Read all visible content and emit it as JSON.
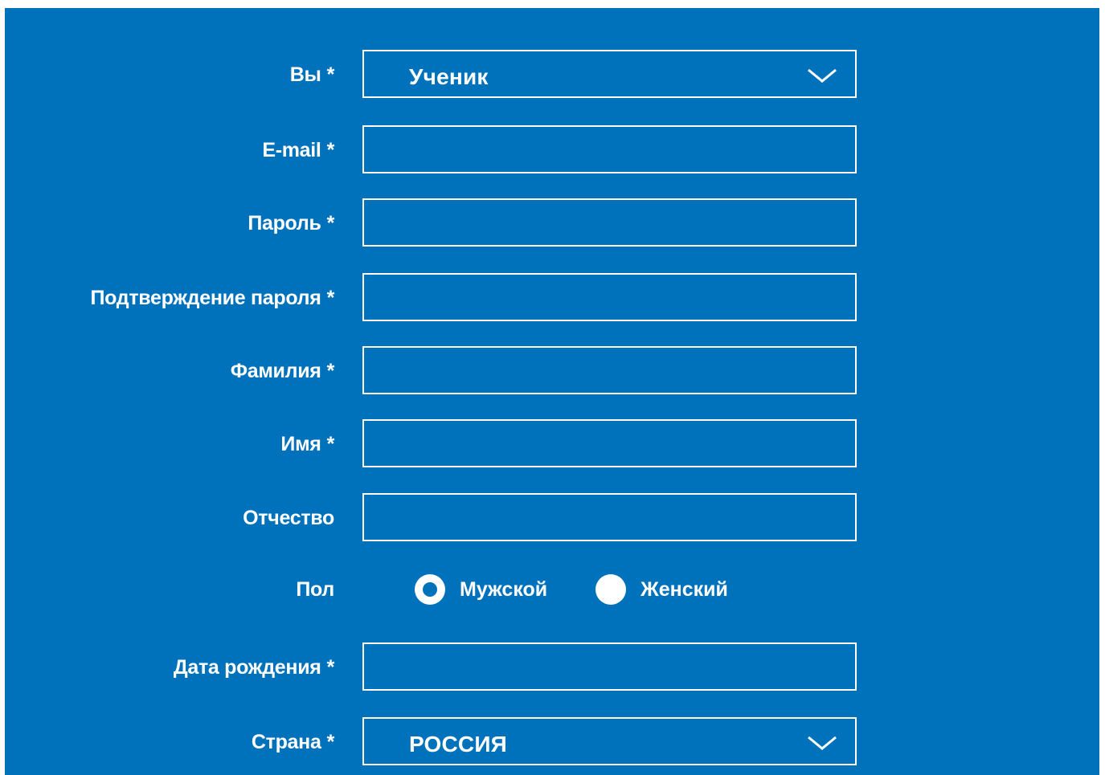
{
  "form": {
    "role": {
      "label": "Вы",
      "required": "*",
      "value": "Ученик"
    },
    "email": {
      "label": "E-mail",
      "required": "*",
      "value": ""
    },
    "password": {
      "label": "Пароль",
      "required": "*",
      "value": ""
    },
    "password_confirm": {
      "label": "Подтверждение пароля",
      "required": "*",
      "value": ""
    },
    "last_name": {
      "label": "Фамилия",
      "required": "*",
      "value": ""
    },
    "first_name": {
      "label": "Имя",
      "required": "*",
      "value": ""
    },
    "patronymic": {
      "label": "Отчество",
      "value": ""
    },
    "gender": {
      "label": "Пол",
      "options": [
        {
          "label": "Мужской",
          "selected": true
        },
        {
          "label": "Женский",
          "selected": false
        }
      ]
    },
    "birth_date": {
      "label": "Дата рождения",
      "required": "*",
      "value": ""
    },
    "country": {
      "label": "Страна",
      "required": "*",
      "value": "РОССИЯ"
    }
  },
  "icons": {
    "select_arrow": "chevron-down-icon",
    "radio_selected": "radio-checked-icon",
    "radio_unselected": "radio-unchecked-icon"
  },
  "colors": {
    "panel_background": "#0072bc",
    "foreground": "#ffffff"
  }
}
